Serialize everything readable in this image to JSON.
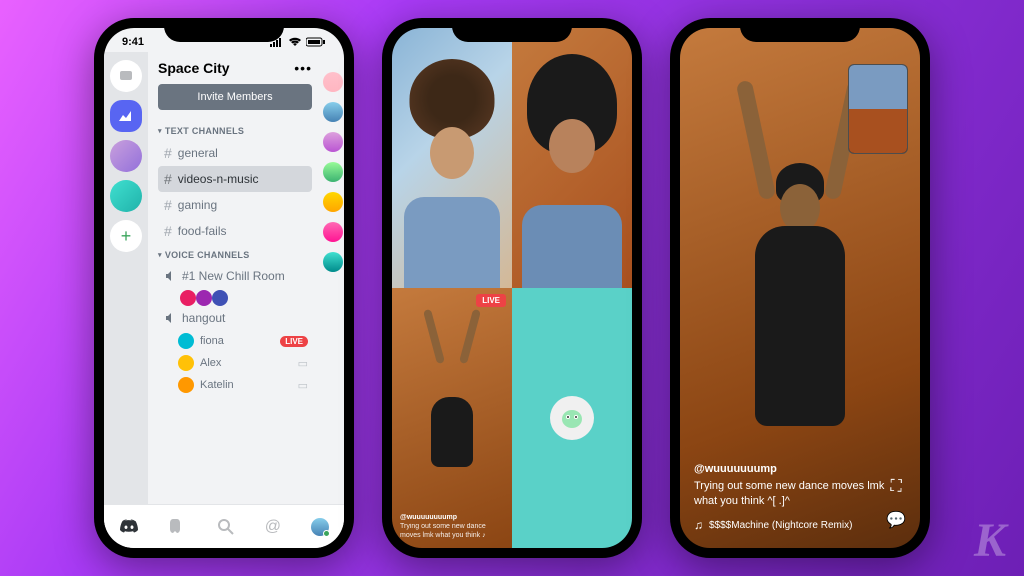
{
  "status": {
    "time": "9:41"
  },
  "server": {
    "name": "Space City",
    "invite_label": "Invite Members",
    "text_section": "TEXT CHANNELS",
    "voice_section": "VOICE CHANNELS",
    "text_channels": [
      "general",
      "videos-n-music",
      "gaming",
      "food-fails"
    ],
    "voice_channels": {
      "chill": {
        "name": "#1 New Chill Room"
      },
      "hangout": {
        "name": "hangout",
        "users": [
          {
            "name": "fiona",
            "live": true
          },
          {
            "name": "Alex",
            "live": false
          },
          {
            "name": "Katelin",
            "live": false
          }
        ]
      }
    }
  },
  "live_badge": "LIVE",
  "stream2": {
    "handle": "@wuuuuuuuump",
    "caption": "Trying out some new dance moves lmk what you think ♪",
    "music_prefix": "♫"
  },
  "stream3": {
    "handle": "@wuuuuuuump",
    "caption": "Trying out some new dance moves lmk what you think ^[ .]^",
    "music": "$$$$Machine (Nightcore Remix)"
  },
  "watermark": "K"
}
